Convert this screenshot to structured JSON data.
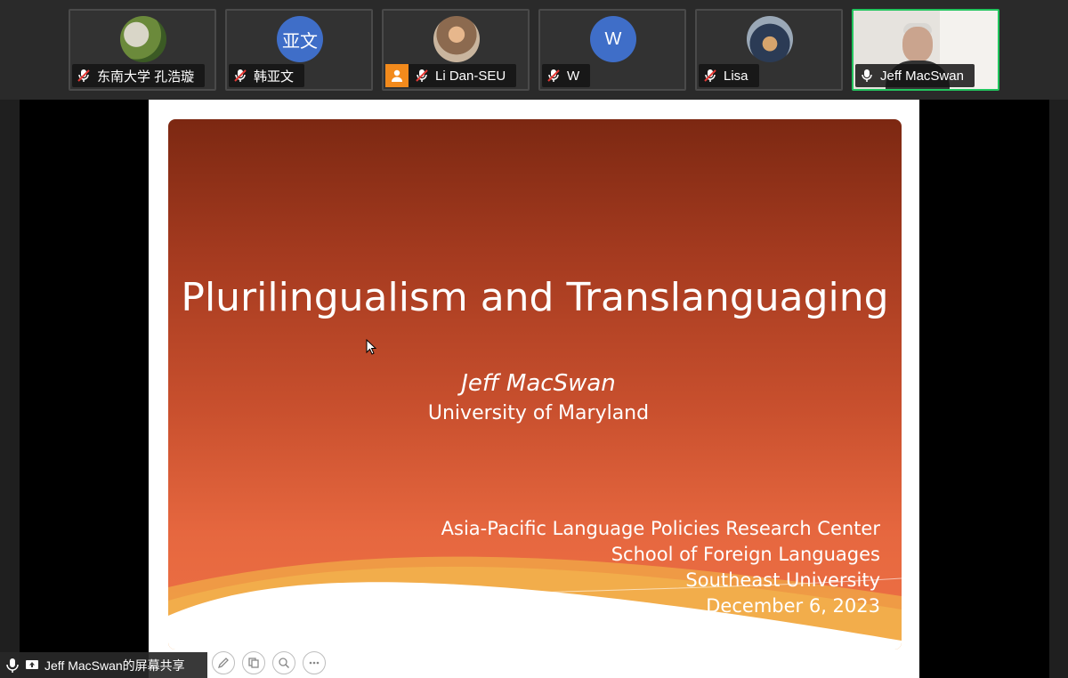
{
  "participants": [
    {
      "name": "东南大学 孔浩璇",
      "avatar_type": "photo",
      "muted": true
    },
    {
      "name": "韩亚文",
      "avatar_text": "亚文",
      "avatar_color": "#3f6ec8",
      "muted": true
    },
    {
      "name": "Li Dan-SEU",
      "avatar_type": "photo",
      "muted": true,
      "host_badge": "person-icon"
    },
    {
      "name": "W",
      "avatar_text": "W",
      "avatar_color": "#3f6ec8",
      "muted": true
    },
    {
      "name": "Lisa",
      "avatar_type": "photo",
      "muted": true
    },
    {
      "name": "Jeff MacSwan",
      "avatar_type": "video",
      "muted": false,
      "active_speaker": true
    }
  ],
  "slide": {
    "title": "Plurilingualism and Translanguaging",
    "author": "Jeff MacSwan",
    "affiliation": "University of Maryland",
    "center": "Asia-Pacific Language Policies Research Center",
    "school": "School of Foreign Languages",
    "university": "Southeast University",
    "date": "December 6, 2023"
  },
  "share_bar": {
    "label": "Jeff MacSwan的屏幕共享"
  },
  "colors": {
    "active_border": "#22c55e",
    "slide_top": "#7c2812",
    "slide_bottom": "#ee7245",
    "avatar_blue": "#3f6ec8"
  }
}
